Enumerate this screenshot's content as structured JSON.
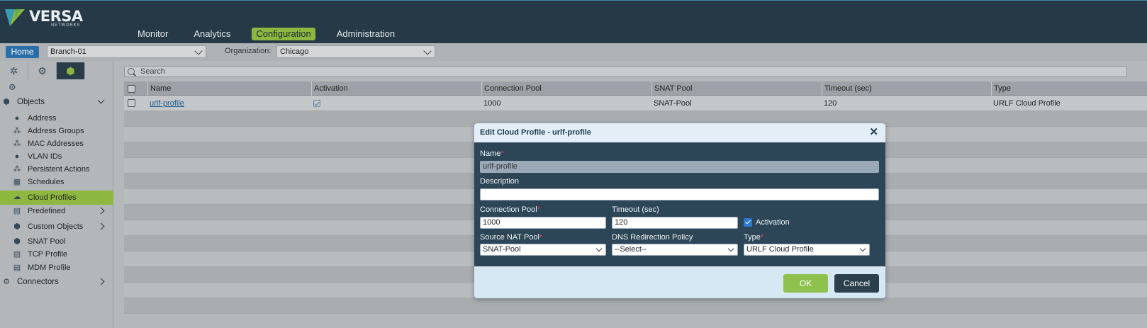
{
  "brand": {
    "name": "VERSA",
    "sub": "NETWORKS"
  },
  "nav": [
    {
      "label": "Monitor",
      "active": false
    },
    {
      "label": "Analytics",
      "active": false
    },
    {
      "label": "Configuration",
      "active": true
    },
    {
      "label": "Administration",
      "active": false
    }
  ],
  "subbar": {
    "home_label": "Home",
    "device_value": "Branch-01",
    "org_label": "Organization:",
    "org_value": "Chicago"
  },
  "sidebar": {
    "tabs": [
      {
        "icon": "network-icon"
      },
      {
        "icon": "gear-icon"
      },
      {
        "icon": "cube-icon"
      }
    ],
    "sub_icon": "globe-gear-icon",
    "items": [
      {
        "label": "Objects",
        "icon": "objects-icon",
        "group": true,
        "expanded": true
      },
      {
        "label": "Address",
        "icon": "pin-icon"
      },
      {
        "label": "Address Groups",
        "icon": "pin-group-icon"
      },
      {
        "label": "MAC Addresses",
        "icon": "pin-group-icon"
      },
      {
        "label": "VLAN IDs",
        "icon": "pin-icon"
      },
      {
        "label": "Persistent Actions",
        "icon": "pin-group-icon"
      },
      {
        "label": "Schedules",
        "icon": "calendar-icon"
      },
      {
        "label": "Cloud Profiles",
        "icon": "cloud-icon",
        "active": true
      },
      {
        "label": "Predefined",
        "icon": "predefined-icon",
        "expandable": true
      },
      {
        "label": "Custom Objects",
        "icon": "custom-objects-icon",
        "expandable": true
      },
      {
        "label": "SNAT Pool",
        "icon": "snat-icon"
      },
      {
        "label": "TCP Profile",
        "icon": "tcp-icon"
      },
      {
        "label": "MDM Profile",
        "icon": "mdm-icon"
      },
      {
        "label": "Connectors",
        "icon": "connectors-icon",
        "group": true,
        "expandable": true
      }
    ]
  },
  "search": {
    "placeholder": "Search"
  },
  "table": {
    "columns": [
      "Name",
      "Activation",
      "Connection Pool",
      "SNAT Pool",
      "Timeout (sec)",
      "Type"
    ],
    "rows": [
      {
        "name": "urlf-profile",
        "activation": true,
        "connection_pool": "1000",
        "snat_pool": "SNAT-Pool",
        "timeout": "120",
        "type": "URLF Cloud Profile"
      }
    ]
  },
  "modal": {
    "title": "Edit Cloud Profile - urlf-profile",
    "close_icon": "close-icon",
    "name_label": "Name",
    "name_value": "urlf-profile",
    "description_label": "Description",
    "description_value": "",
    "connection_pool_label": "Connection Pool",
    "connection_pool_value": "1000",
    "timeout_label": "Timeout (sec)",
    "timeout_value": "120",
    "activation_label": "Activation",
    "activation_checked": true,
    "source_nat_label": "Source NAT Pool",
    "source_nat_value": "SNAT-Pool",
    "dns_label": "DNS Redirection Policy",
    "dns_value": "--Select--",
    "type_label": "Type",
    "type_value": "URLF Cloud Profile",
    "ok_label": "OK",
    "cancel_label": "Cancel",
    "required_mark": "*"
  },
  "colors": {
    "accent": "#8db83f",
    "topbar": "#253947",
    "modal_body": "#2c4557"
  }
}
